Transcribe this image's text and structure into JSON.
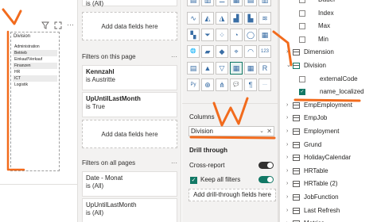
{
  "canvas": {
    "header_icons": [
      "filter-icon",
      "focus-mode-icon",
      "more-options-icon"
    ],
    "slicer": {
      "title": "Division",
      "items": [
        "Administration",
        "Betrieb",
        "Einkauf/Verkauf",
        "Finanzen",
        "HR",
        "ICT",
        "Logistik"
      ]
    }
  },
  "filters": {
    "top_card": {
      "subtitle": "is (All)"
    },
    "add_fields_1": "Add data fields here",
    "on_page_label": "Filters on this page",
    "cards": [
      {
        "title": "Kennzahl",
        "subtitle": "is Austritte"
      },
      {
        "title": "UpUntilLastMonth",
        "subtitle": "is True"
      }
    ],
    "add_fields_2": "Add data fields here",
    "all_pages_label": "Filters on all pages",
    "all_pages_cards": [
      {
        "title": "Date - Monat",
        "subtitle": "is (All)"
      },
      {
        "title": "UpUntilLastMonth",
        "subtitle": "is (All)"
      }
    ],
    "more_glyph": "···"
  },
  "visualizations": {
    "columns_label": "Columns",
    "columns_field": "Division",
    "drill_through": "Drill through",
    "cross_report": "Cross-report",
    "cross_report_toggle": "Off",
    "keep_all_filters": "Keep all filters",
    "keep_all_filters_toggle": "On",
    "add_drill_fields": "Add drill-through fields here",
    "icon_names": [
      [
        "stacked-bar-icon",
        "stacked-column-icon",
        "clustered-bar-icon",
        "clustered-column-icon",
        "100-bar-icon",
        "100-column-icon"
      ],
      [
        "line-chart-icon",
        "area-chart-icon",
        "stacked-area-icon",
        "line-column-icon",
        "line-clustered-icon",
        "ribbon-icon"
      ],
      [
        "waterfall-icon",
        "funnel-icon",
        "scatter-icon",
        "pie-icon",
        "donut-icon",
        "treemap-icon"
      ],
      [
        "map-icon",
        "filled-map-icon",
        "shape-map-icon",
        "azure-map-icon",
        "gauge-icon",
        "card-icon"
      ],
      [
        "multirow-card-icon",
        "kpi-icon",
        "slicer-icon",
        "table-icon",
        "matrix-icon",
        "r-visual-icon"
      ],
      [
        "python-visual-icon",
        "key-influencers-icon",
        "decomposition-tree-icon",
        "qna-icon",
        "narrative-icon",
        "more-visuals-icon"
      ]
    ],
    "icon_glyphs": [
      [
        "▤",
        "▥",
        "☰",
        "▦",
        "▤",
        "▥"
      ],
      [
        "∿",
        "◭",
        "◮",
        "▟",
        "▙",
        "≋"
      ],
      [
        "▚",
        "⏷",
        "⁘",
        "◔",
        "◯",
        "▦"
      ],
      [
        "🌐",
        "▰",
        "◆",
        "⌖",
        "◠",
        "123"
      ],
      [
        "▤",
        "▲",
        "▽",
        "▦",
        "▦",
        "R"
      ],
      [
        "Py",
        "⊕",
        "⋔",
        "💬",
        "¶",
        "···"
      ]
    ]
  },
  "fields": {
    "rows": [
      {
        "kind": "measure",
        "label": "Dauer",
        "indent": 2,
        "checked": false
      },
      {
        "kind": "measure",
        "label": "Index",
        "indent": 2,
        "checked": false
      },
      {
        "kind": "measure",
        "label": "Max",
        "indent": 2,
        "checked": false
      },
      {
        "kind": "measure",
        "label": "Min",
        "indent": 2,
        "checked": false
      },
      {
        "kind": "table",
        "label": "Dimension",
        "indent": 0,
        "expanded": false
      },
      {
        "kind": "table",
        "label": "Division",
        "indent": 0,
        "expanded": true
      },
      {
        "kind": "field",
        "label": "externalCode",
        "indent": 1,
        "checked": false
      },
      {
        "kind": "field",
        "label": "name_localized",
        "indent": 1,
        "checked": true
      },
      {
        "kind": "table",
        "label": "EmpEmployment",
        "indent": 0,
        "expanded": false
      },
      {
        "kind": "table",
        "label": "EmpJob",
        "indent": 0,
        "expanded": false
      },
      {
        "kind": "table",
        "label": "Employment",
        "indent": 0,
        "expanded": false
      },
      {
        "kind": "table",
        "label": "Grund",
        "indent": 0,
        "expanded": false
      },
      {
        "kind": "table",
        "label": "HolidayCalendar",
        "indent": 0,
        "expanded": false
      },
      {
        "kind": "table",
        "label": "HRTable",
        "indent": 0,
        "expanded": false
      },
      {
        "kind": "table",
        "label": "HRTable (2)",
        "indent": 0,
        "expanded": false
      },
      {
        "kind": "table",
        "label": "JobFunction",
        "indent": 0,
        "expanded": false
      },
      {
        "kind": "table",
        "label": "Last Refresh",
        "indent": 0,
        "expanded": false
      },
      {
        "kind": "table",
        "label": "Metrics",
        "indent": 0,
        "expanded": false
      }
    ]
  },
  "colors": {
    "annotation": "#f26b1d",
    "accent": "#117865",
    "pane_bg": "#f3f2f1"
  }
}
